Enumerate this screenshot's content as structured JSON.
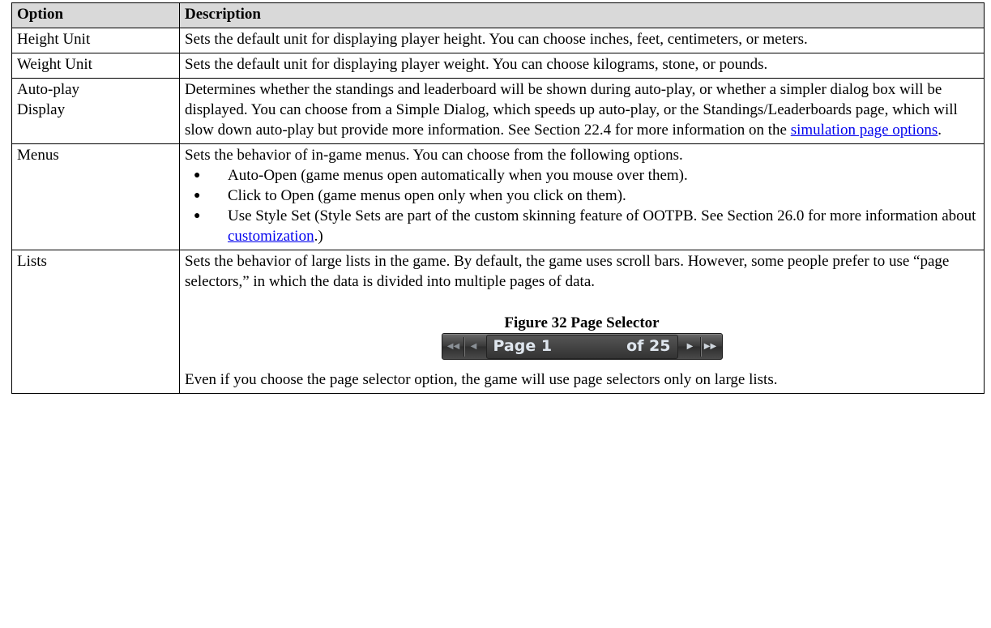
{
  "table": {
    "header": {
      "option": "Option",
      "description": "Description"
    },
    "rows": {
      "height_unit": {
        "option": "Height Unit",
        "text": "Sets the default unit for displaying player height. You can choose inches, feet, centimeters, or meters."
      },
      "weight_unit": {
        "option": "Weight Unit",
        "text": "Sets the default unit for displaying player weight. You can choose kilograms, stone, or pounds."
      },
      "autoplay": {
        "option_line1": "Auto-play",
        "option_line2": "Display",
        "text": "Determines whether the standings and leaderboard will be shown during auto-play, or whether a simpler dialog box will be displayed. You can choose from a Simple Dialog, which speeds up auto-play, or the Standings/Leaderboards page, which will slow down auto-play but provide more information. See Section 22.4 for more information on the ",
        "link": "simulation page options",
        "text_end": "."
      },
      "menus": {
        "option": "Menus",
        "intro": "Sets the behavior of in-game menus. You can choose from the following options.",
        "bullets": [
          {
            "text": "Auto-Open (game menus open automatically when you mouse over them)."
          },
          {
            "text": "Click to Open (game menus open only when you click on them)."
          },
          {
            "text": "Use Style Set (Style Sets are part of the custom skinning feature of OOTPB. See Section 26.0 for more information about ",
            "link": "customization",
            "text_end": ".)"
          }
        ]
      },
      "lists": {
        "option": "Lists",
        "text": "Sets the behavior of large lists in the game. By default, the game uses scroll bars. However, some people prefer to use “page selectors,” in which the data is divided into multiple pages of data.",
        "figure_caption": "Figure 32 Page Selector",
        "pager": {
          "page_label": "Page 1",
          "of_label": "of 25",
          "first_icon": "double-left-arrow-icon",
          "prev_icon": "left-arrow-icon",
          "next_icon": "right-arrow-icon",
          "last_icon": "double-right-arrow-icon"
        },
        "text2": "Even if you choose the page selector option, the game will use page selectors only on large lists."
      }
    }
  }
}
